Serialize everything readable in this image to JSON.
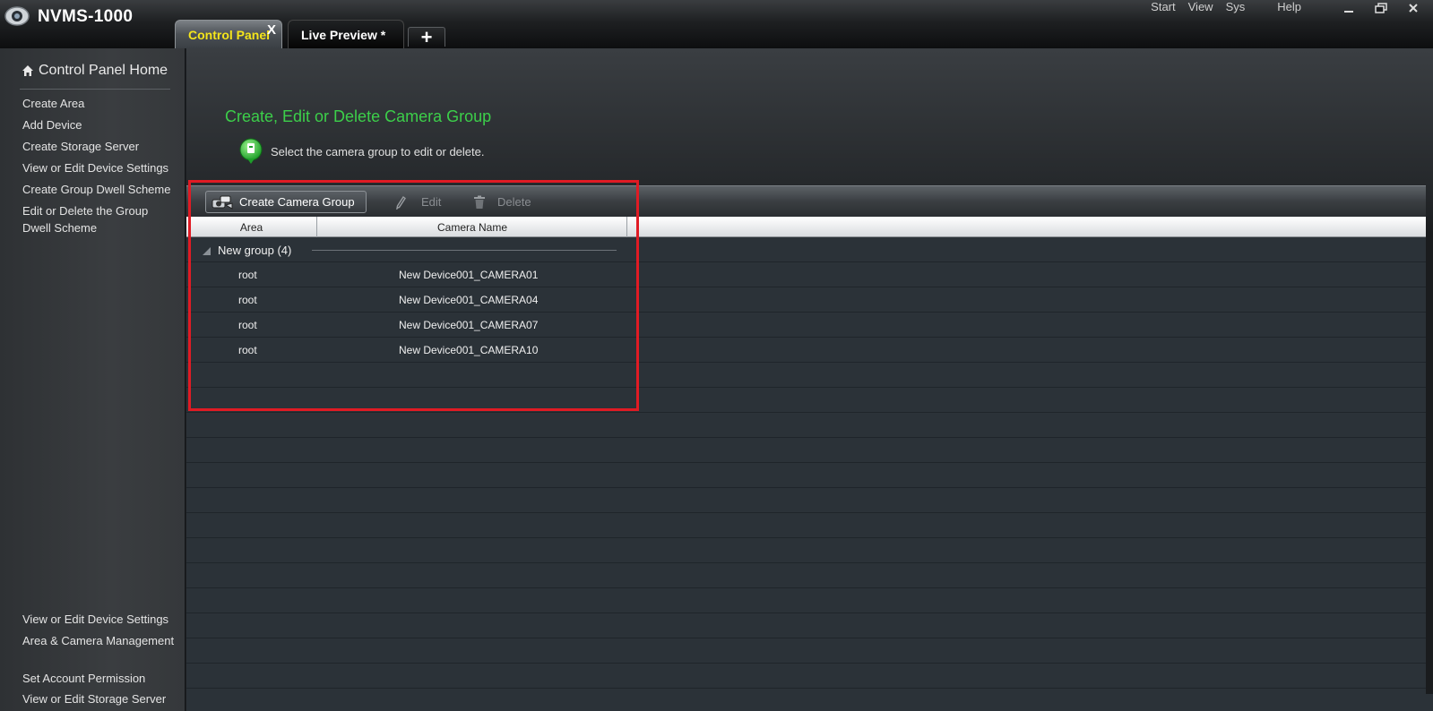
{
  "app": {
    "title": "NVMS-1000"
  },
  "menu": {
    "items": [
      "Start",
      "View",
      "Sys",
      "Help"
    ]
  },
  "tabs": [
    {
      "label": "Control Panel",
      "close": "X"
    },
    {
      "label": "Live Preview *"
    }
  ],
  "tab_add_label": "+",
  "sidebar": {
    "home": "Control Panel Home",
    "items": [
      "Create Area",
      "Add Device",
      "Create Storage Server",
      "View or Edit Device Settings",
      "Create Group Dwell Scheme",
      "Edit or Delete the Group Dwell Scheme"
    ],
    "bottom_items": [
      "View or Edit Device Settings",
      "Area & Camera Management",
      "Set Account Permission",
      "View or Edit Storage Server"
    ]
  },
  "main": {
    "heading": "Create, Edit or Delete Camera Group",
    "hint": "Select the camera group to edit or delete."
  },
  "toolbar": {
    "create_label": "Create Camera Group",
    "edit_label": "Edit",
    "delete_label": "Delete"
  },
  "grid": {
    "columns": [
      "Area",
      "Camera Name"
    ],
    "group": {
      "label": "New group (4)"
    },
    "rows": [
      {
        "area": "root",
        "camera": "New Device001_CAMERA01"
      },
      {
        "area": "root",
        "camera": "New Device001_CAMERA04"
      },
      {
        "area": "root",
        "camera": "New Device001_CAMERA07"
      },
      {
        "area": "root",
        "camera": "New Device001_CAMERA10"
      }
    ]
  },
  "colors": {
    "heading_green": "#3ccf4a",
    "active_tab_text": "#f5e51b",
    "highlight_red": "#e01b24"
  }
}
